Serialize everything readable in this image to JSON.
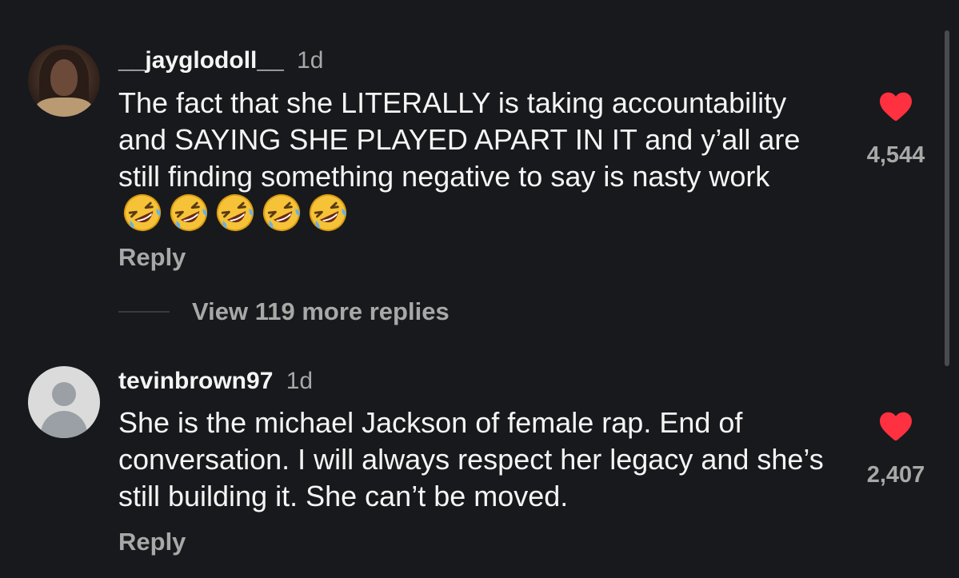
{
  "comments": [
    {
      "username": "__jayglodoll__",
      "time": "1d",
      "text": "The fact that she LITERALLY is taking accountability and SAYING SHE PLAYED APART IN IT and y’all are still finding something negative to say is nasty work",
      "emoji_count": 5,
      "emoji": "rolling-on-the-floor-laughing",
      "likes": "4,544",
      "reply_label": "Reply",
      "avatar": "profile-photo"
    },
    {
      "username": "tevinbrown97",
      "time": "1d",
      "text": "She is the michael Jackson of female rap. End of conversation. I will always respect her legacy and she’s still building it. She can’t be moved.",
      "likes": "2,407",
      "reply_label": "Reply",
      "avatar": "default-avatar"
    }
  ],
  "view_replies_label": "View 119 more replies",
  "colors": {
    "background": "#18191c",
    "text": "#f5f5f5",
    "muted": "#a8a8a8",
    "heart": "#ff3040"
  },
  "icons": {
    "like": "heart-icon",
    "emoji": "rofl-emoji-icon"
  }
}
